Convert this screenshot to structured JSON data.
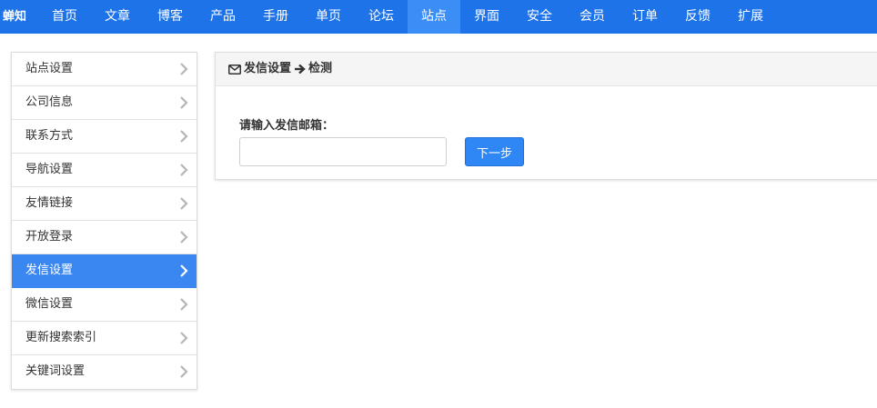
{
  "navbar": {
    "brand": "蝉知",
    "items": [
      {
        "label": "首页"
      },
      {
        "label": "文章"
      },
      {
        "label": "博客"
      },
      {
        "label": "产品"
      },
      {
        "label": "手册"
      },
      {
        "label": "单页"
      },
      {
        "label": "论坛"
      },
      {
        "label": "站点",
        "active": true
      },
      {
        "label": "界面"
      },
      {
        "label": "安全"
      },
      {
        "label": "会员"
      },
      {
        "label": "订单"
      },
      {
        "label": "反馈"
      },
      {
        "label": "扩展"
      }
    ],
    "colors": {
      "background": "#1e73e8",
      "active": "#3a8ef6"
    }
  },
  "sidebar": {
    "items": [
      {
        "label": "站点设置"
      },
      {
        "label": "公司信息"
      },
      {
        "label": "联系方式"
      },
      {
        "label": "导航设置"
      },
      {
        "label": "友情链接"
      },
      {
        "label": "开放登录"
      },
      {
        "label": "发信设置",
        "active": true
      },
      {
        "label": "微信设置"
      },
      {
        "label": "更新搜索索引"
      },
      {
        "label": "关键词设置"
      }
    ],
    "chevron_icon": "chevron-right-icon",
    "colors": {
      "active": "#3a87f2"
    }
  },
  "panel": {
    "header_icon": "envelope-icon",
    "header_title": "发信设置",
    "header_arrow_icon": "arrow-right-icon",
    "header_subtitle": "检测",
    "form": {
      "label": "请输入发信邮箱：",
      "email_value": "",
      "next_label": "下一步"
    }
  }
}
